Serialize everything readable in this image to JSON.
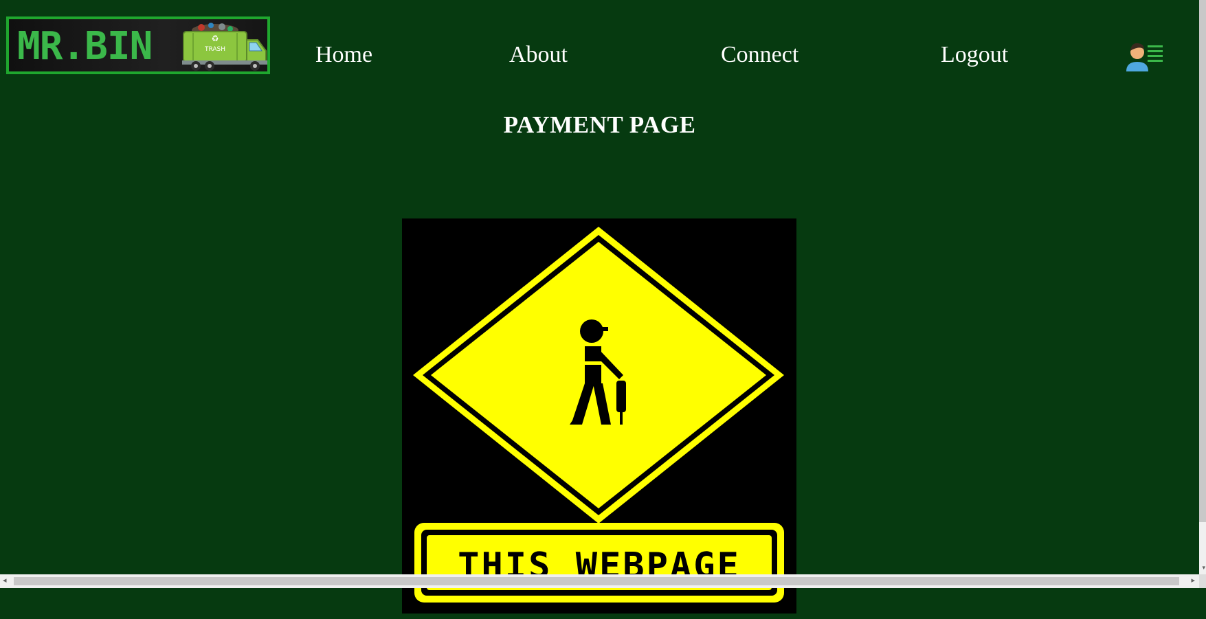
{
  "brand": {
    "logo_text": "MR.BIN",
    "truck_label": "TRASH"
  },
  "nav": {
    "items": [
      {
        "label": "Home"
      },
      {
        "label": "About"
      },
      {
        "label": "Connect"
      },
      {
        "label": "Logout"
      }
    ],
    "user_menu_icon": "user-menu-icon"
  },
  "main": {
    "title": "PAYMENT PAGE",
    "image": {
      "sign_text": "THIS WEBPAGE"
    }
  },
  "colors": {
    "background": "#063a10",
    "logo_border": "#1fa72e",
    "logo_text": "#3bb84a",
    "nav_text": "#ffffff",
    "sign_yellow": "#ffff00",
    "sign_black": "#000000"
  }
}
